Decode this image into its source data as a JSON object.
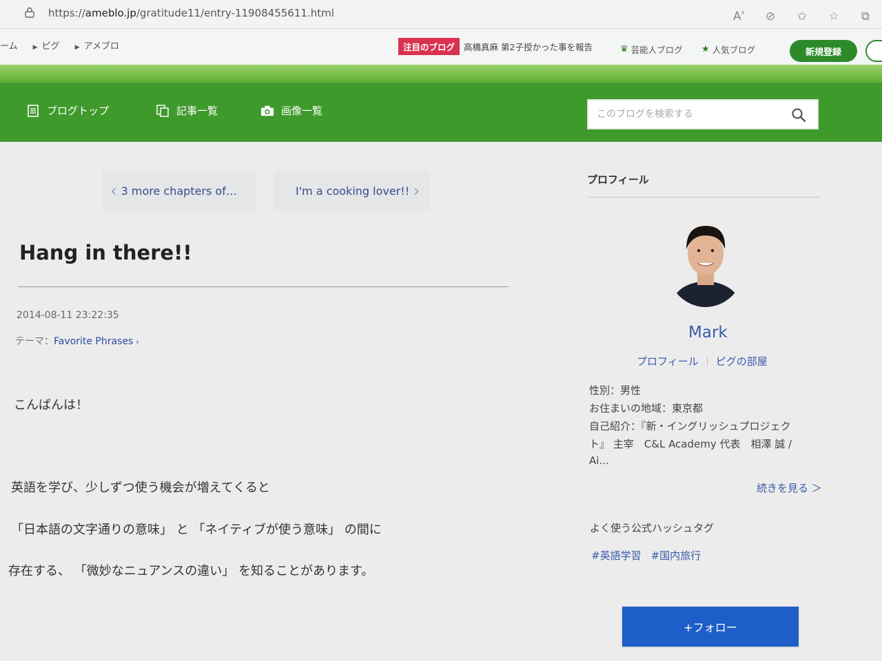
{
  "browser": {
    "url_prefix": "https://",
    "url_host": "ameblo.jp",
    "url_path": "/gratitude11/entry-11908455611.html",
    "icons": [
      "read-aloud-icon",
      "tracking-icon",
      "favorites-add-icon",
      "favorites-icon",
      "collections-icon"
    ]
  },
  "ameba_header": {
    "crumbs": [
      "ーム",
      "ピグ",
      "アメブロ"
    ],
    "notice_tag": "注目のブログ",
    "notice_text": "高橋真麻 第2子授かった事を報告",
    "celebrity_blog": "芸能人ブログ",
    "popular_blog": "人気ブログ",
    "signup": "新規登録"
  },
  "blog_nav": {
    "items": [
      {
        "label": "ブログトップ",
        "icon": "document-icon"
      },
      {
        "label": "記事一覧",
        "icon": "pages-icon"
      },
      {
        "label": "画像一覧",
        "icon": "camera-icon"
      }
    ],
    "search_placeholder": "このブログを検索する"
  },
  "entry": {
    "prev_label": "3 more chapters of…",
    "next_label": "I'm a cooking lover!!",
    "title": "Hang in there!!",
    "date": "2014-08-11 23:22:35",
    "theme_label": "テーマ：",
    "theme_value": "Favorite Phrases",
    "paragraphs": [
      "こんばんは！",
      "英語を学び、少しずつ使う機会が増えてくると",
      "「日本語の文字通りの意味」 と 「ネイティブが使う意味」 の間に",
      "存在する、 「微妙なニュアンスの違い」 を知ることがあります。"
    ]
  },
  "profile": {
    "heading": "プロフィール",
    "name": "Mark",
    "link_profile": "プロフィール",
    "link_room": "ピグの部屋",
    "gender": "性別：男性",
    "area": "お住まいの地域：東京都",
    "intro_line1": "自己紹介：『新・イングリッシュプロジェク",
    "intro_line2": "ト』 主宰　C&L Academy 代表　相澤 誠 /",
    "intro_line3": "Ai...",
    "more": "続きを見る ＞",
    "hashtag_heading": "よく使う公式ハッシュタグ",
    "hashtags": [
      "#英語学習",
      "#国内旅行"
    ],
    "follow": "+フォロー"
  },
  "colors": {
    "nav_green": "#3f9a2c",
    "signup_green": "#2d8a2a",
    "notice_red": "#d93250",
    "follow_blue": "#1e5ec8",
    "link_blue": "#3a5aa8"
  }
}
